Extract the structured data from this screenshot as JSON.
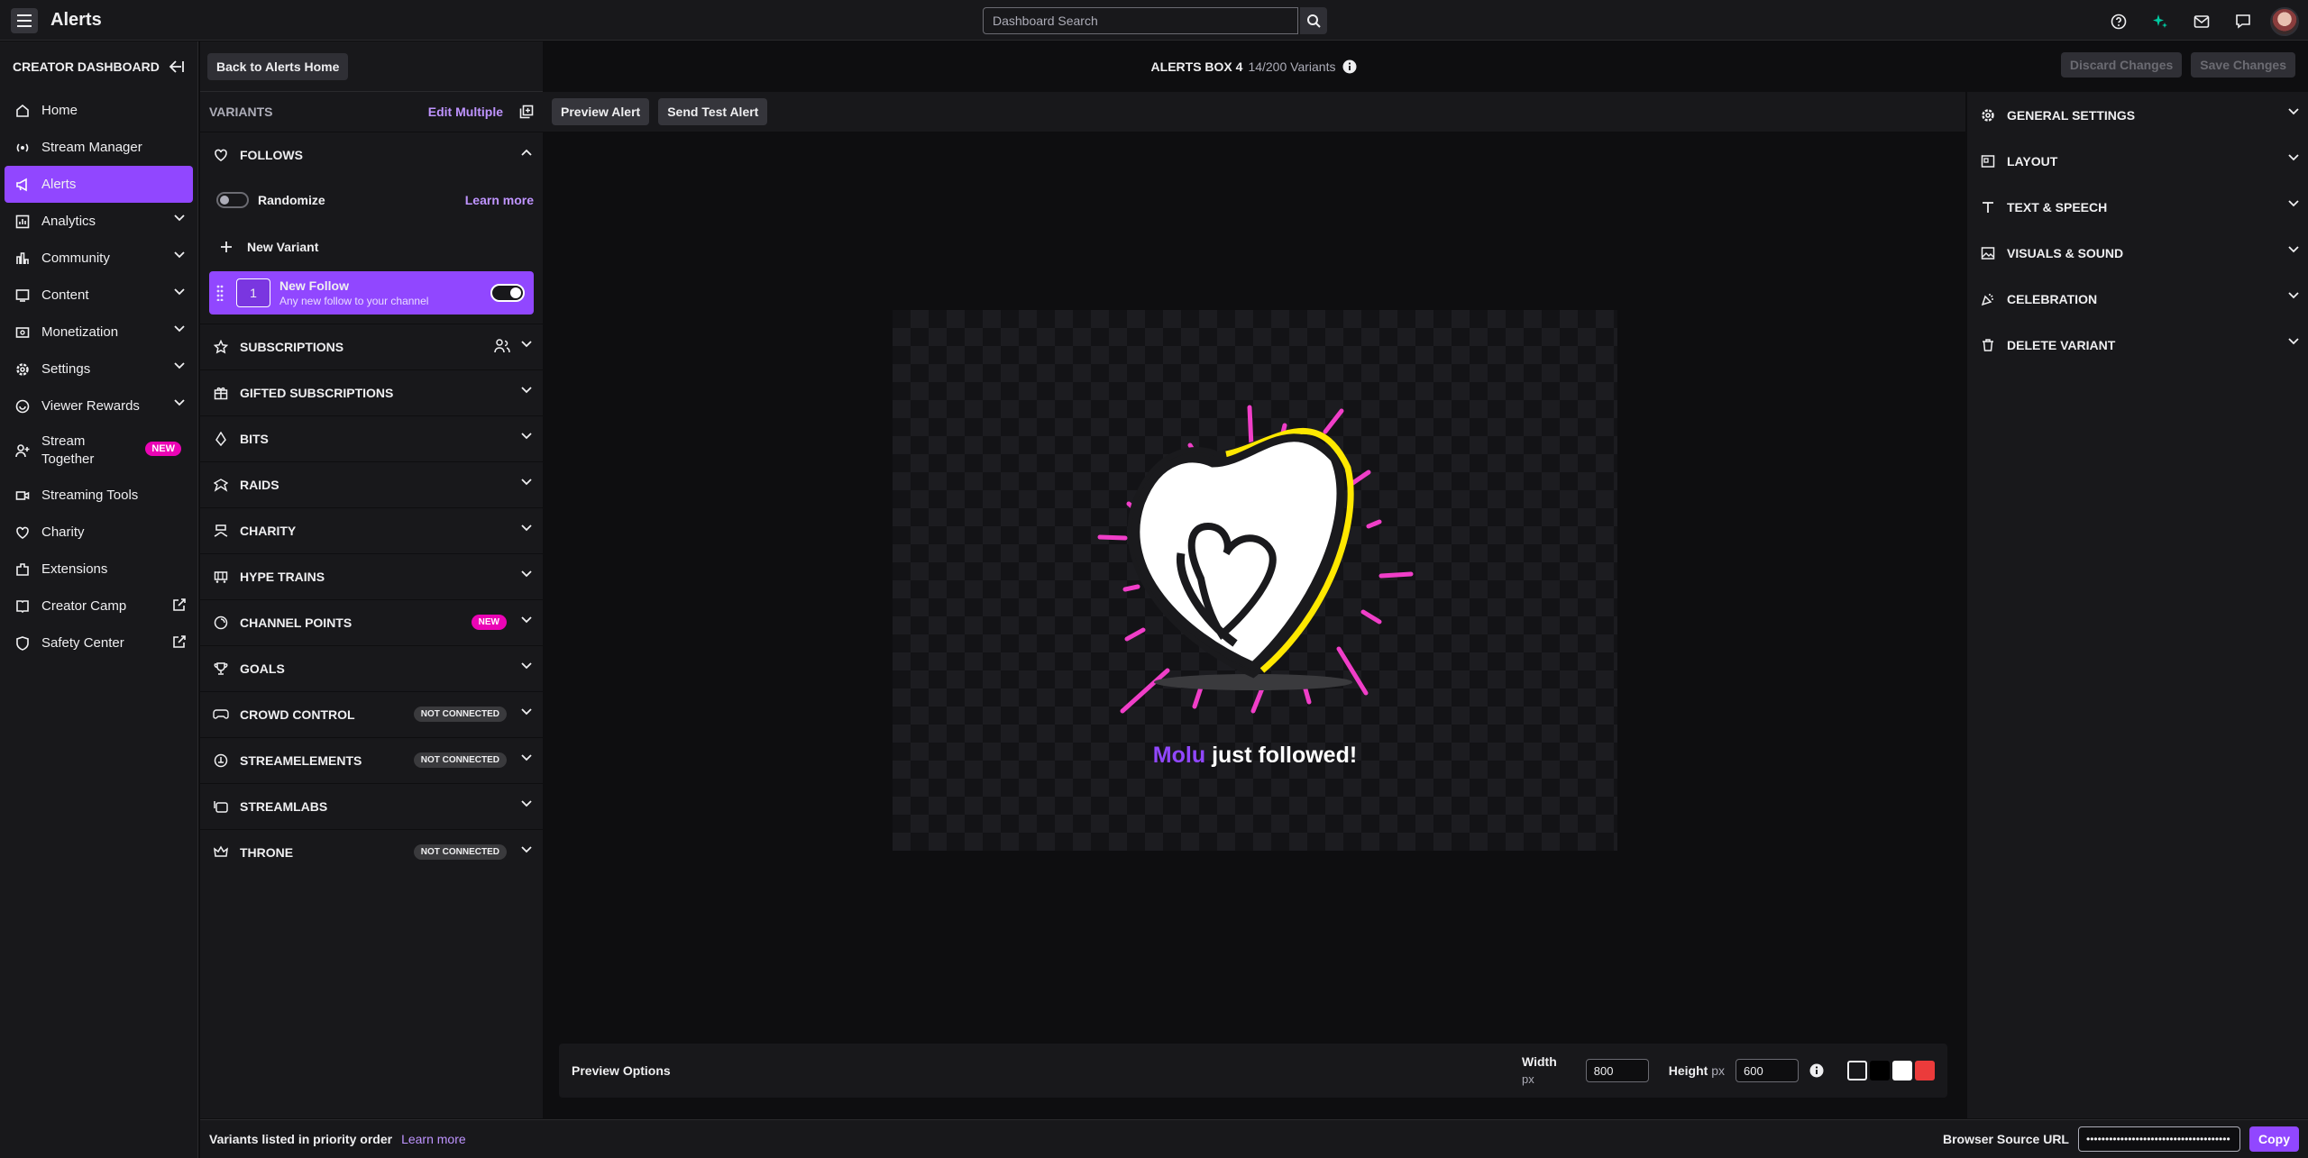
{
  "topbar": {
    "title": "Alerts",
    "search_placeholder": "Dashboard Search"
  },
  "nav": {
    "heading": "CREATOR DASHBOARD",
    "items": [
      {
        "label": "Home"
      },
      {
        "label": "Stream Manager"
      },
      {
        "label": "Alerts"
      },
      {
        "label": "Analytics"
      },
      {
        "label": "Community"
      },
      {
        "label": "Content"
      },
      {
        "label": "Monetization"
      },
      {
        "label": "Settings"
      },
      {
        "label": "Viewer Rewards"
      },
      {
        "label": "Stream Together",
        "badge": "NEW"
      },
      {
        "label": "Streaming Tools"
      },
      {
        "label": "Charity"
      },
      {
        "label": "Extensions"
      },
      {
        "label": "Creator Camp"
      },
      {
        "label": "Safety Center"
      }
    ]
  },
  "variants": {
    "back_label": "Back to Alerts Home",
    "heading": "VARIANTS",
    "edit_multiple": "Edit Multiple",
    "follows": {
      "title": "FOLLOWS",
      "randomize": "Randomize",
      "learn_more": "Learn more",
      "new_variant": "New Variant",
      "card": {
        "priority": "1",
        "title": "New Follow",
        "subtitle": "Any new follow to your channel"
      }
    },
    "sections": [
      {
        "title": "SUBSCRIPTIONS"
      },
      {
        "title": "GIFTED SUBSCRIPTIONS"
      },
      {
        "title": "BITS"
      },
      {
        "title": "RAIDS"
      },
      {
        "title": "CHARITY"
      },
      {
        "title": "HYPE TRAINS"
      },
      {
        "title": "CHANNEL POINTS",
        "badge": "NEW"
      },
      {
        "title": "GOALS"
      },
      {
        "title": "CROWD CONTROL",
        "status": "NOT CONNECTED"
      },
      {
        "title": "STREAMELEMENTS",
        "status": "NOT CONNECTED"
      },
      {
        "title": "STREAMLABS"
      },
      {
        "title": "THRONE",
        "status": "NOT CONNECTED"
      }
    ]
  },
  "center": {
    "box_title": "ALERTS BOX 4",
    "variant_count": "14/200 Variants",
    "preview_alert": "Preview Alert",
    "send_test": "Send Test Alert",
    "alert": {
      "user": "Molu",
      "message": "just followed!"
    },
    "preview_options": {
      "label": "Preview Options",
      "width_label": "Width",
      "width_unit": "px",
      "width_value": "800",
      "height_label": "Height",
      "height_unit": "px",
      "height_value": "600",
      "swatches": [
        "#18181b",
        "#000000",
        "#ffffff",
        "#eb3b3b"
      ]
    }
  },
  "settings": {
    "discard": "Discard Changes",
    "save": "Save Changes",
    "sections": [
      {
        "title": "GENERAL SETTINGS"
      },
      {
        "title": "LAYOUT"
      },
      {
        "title": "TEXT & SPEECH"
      },
      {
        "title": "VISUALS & SOUND"
      },
      {
        "title": "CELEBRATION"
      },
      {
        "title": "DELETE VARIANT"
      }
    ]
  },
  "footer": {
    "priority_note": "Variants listed in priority order",
    "learn_more": "Learn more",
    "browser_source_label": "Browser Source URL",
    "browser_source_value": "••••••••••••••••••••••••••••••••••••••",
    "copy": "Copy"
  },
  "colors": {
    "accent": "#9147ff",
    "badge_new": "#eb04b5",
    "background": "#0e0e10",
    "panel": "#18181b"
  }
}
